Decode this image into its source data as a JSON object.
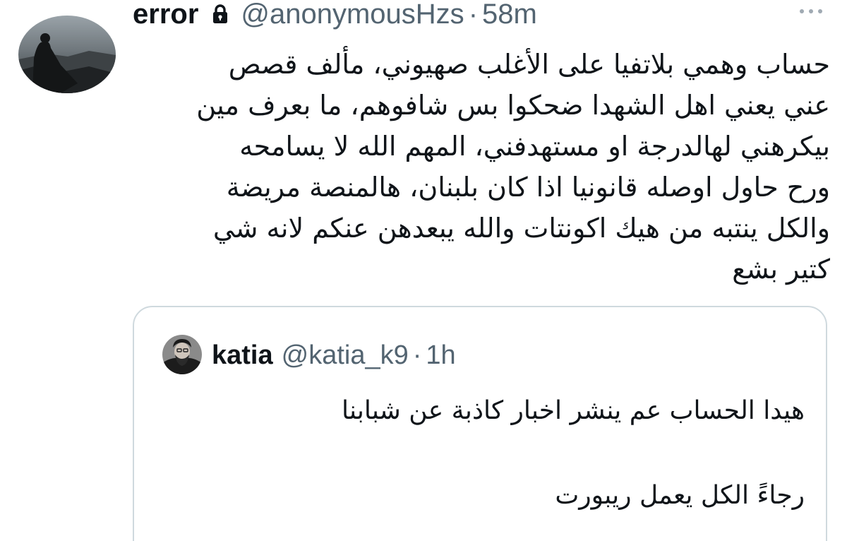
{
  "tweet": {
    "author": {
      "display_name": "error",
      "protected_icon": "lock-icon",
      "handle": "@anonymousHzs",
      "separator": "·",
      "time": "58m"
    },
    "more_icon": "more-horizontal-icon",
    "body_lines": [
      "حساب وهمي بلاتفيا على الأغلب صهيوني، مألف قصص",
      "عني يعني اهل الشهدا ضحكوا بس شافوهم، ما بعرف مين",
      "بيكرهني لهالدرجة او مستهدفني، المهم الله لا يسامحه",
      "ورح حاول اوصله قانونيا اذا كان بلبنان، هالمنصة مريضة",
      "والكل ينتبه من هيك اكونتات والله يبعدهن عنكم لانه شي",
      "كتير بشع"
    ]
  },
  "quoted_tweet": {
    "author": {
      "display_name": "katia",
      "handle": "@katia_k9",
      "separator": "·",
      "time": "1h"
    },
    "body_lines": [
      "هيدا الحساب عم ينشر اخبار كاذبة عن شبابنا",
      "رجاءً الكل يعمل ريبورت"
    ]
  },
  "colors": {
    "text": "#0f1419",
    "secondary": "#536471",
    "border": "#cfd9de"
  }
}
